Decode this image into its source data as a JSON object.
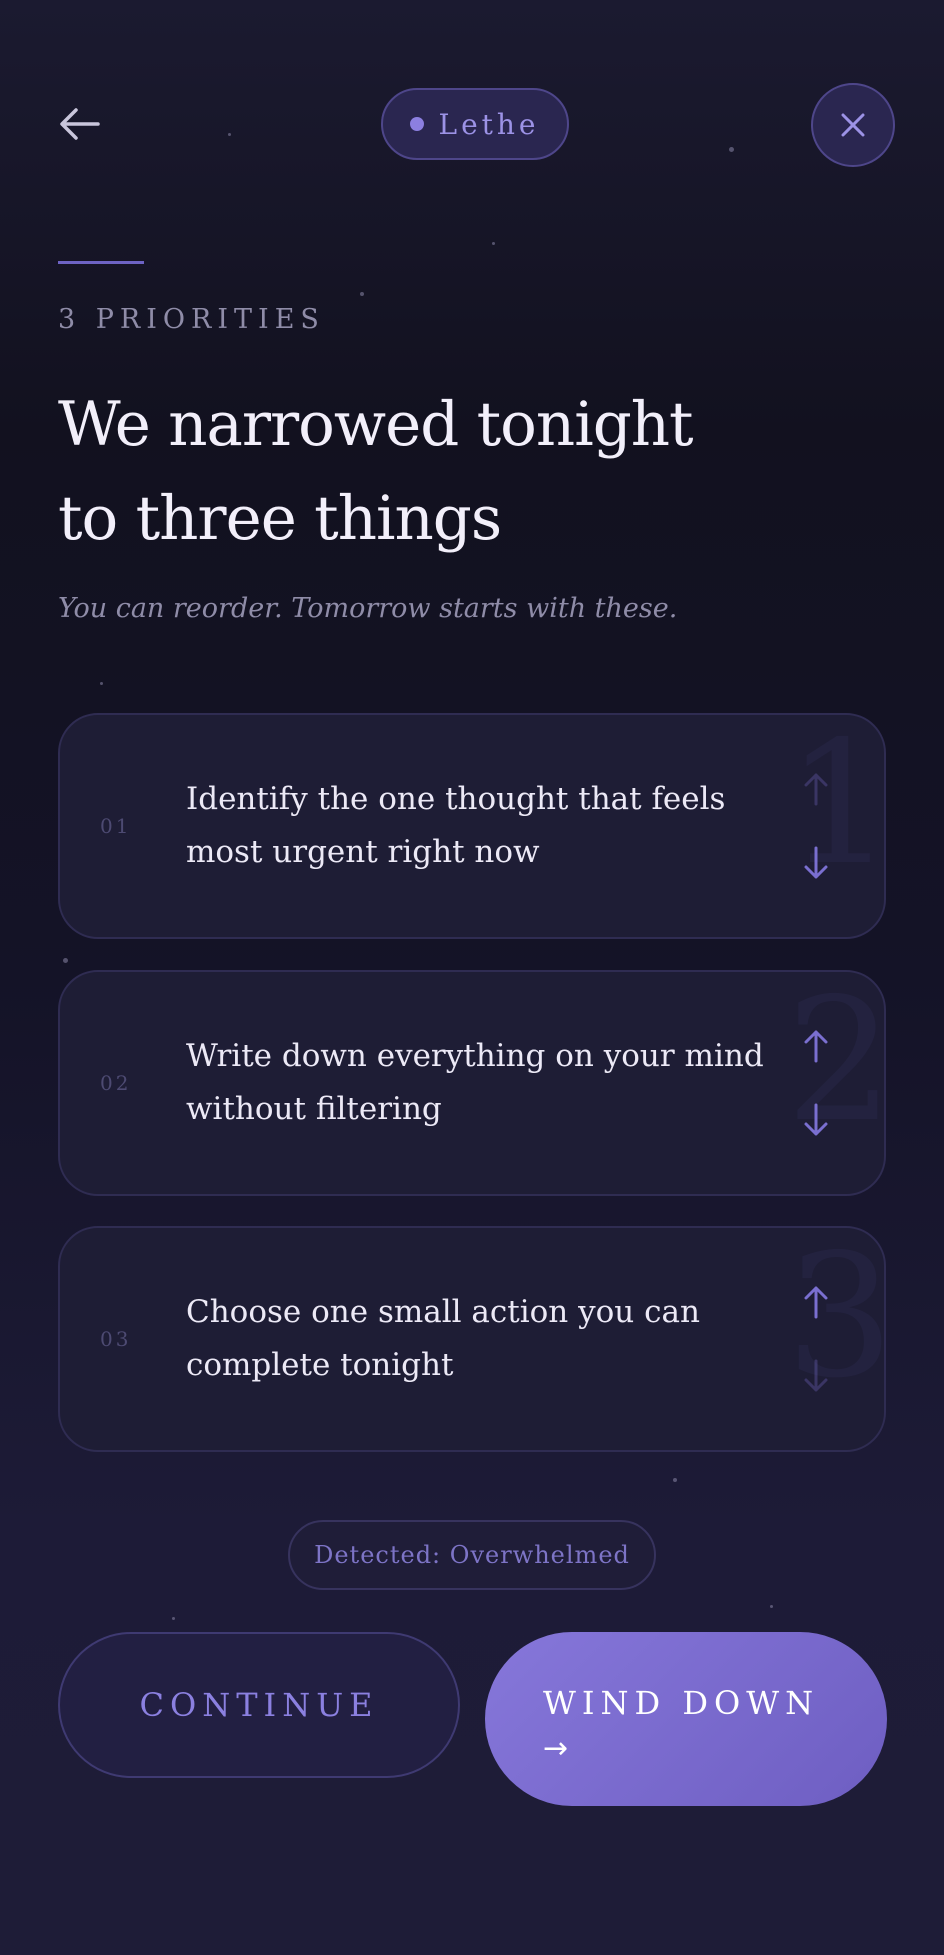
{
  "header": {
    "brand_label": "Lethe",
    "accent_color": "#8c7fe0"
  },
  "hero": {
    "eyebrow": "3 PRIORITIES",
    "title_line1": "We narrowed tonight",
    "title_line2": "to three things",
    "subtitle": "You can reorder. Tomorrow starts with these."
  },
  "priorities": [
    {
      "num": "01",
      "big": "1",
      "text": "Identify the one thought that feels most urgent right now",
      "can_move_up": false,
      "can_move_down": true
    },
    {
      "num": "02",
      "big": "2",
      "text": "Write down everything on your mind without filtering",
      "can_move_up": true,
      "can_move_down": true
    },
    {
      "num": "03",
      "big": "3",
      "text": "Choose one small action you can complete tonight",
      "can_move_up": true,
      "can_move_down": false
    }
  ],
  "detected_chip": "Detected: Overwhelmed",
  "actions": {
    "continue_label": "CONTINUE",
    "wind_down_label": "WIND DOWN",
    "wind_down_arrow": "→"
  }
}
